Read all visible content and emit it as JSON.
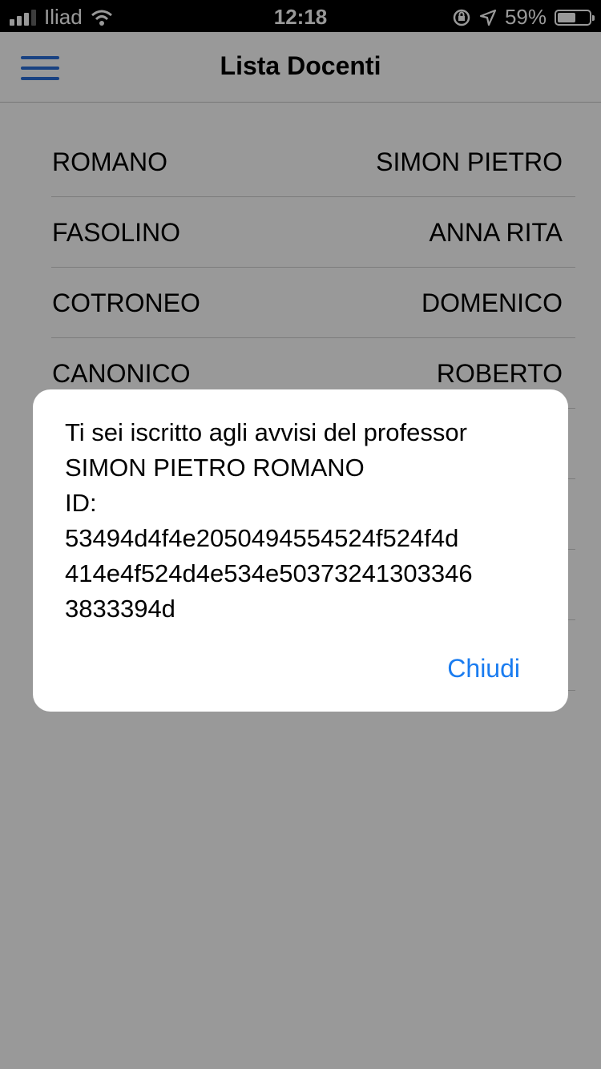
{
  "status_bar": {
    "carrier": "Iliad",
    "time": "12:18",
    "battery_percent": "59%",
    "battery_level": 0.59,
    "icons": [
      "signal-icon",
      "wifi-icon",
      "orientation-lock-icon",
      "location-icon",
      "battery-icon"
    ]
  },
  "navbar": {
    "title": "Lista Docenti",
    "menu_icon": "hamburger-icon",
    "accent_color": "#2b6ed9"
  },
  "teachers": [
    {
      "surname": "ROMANO",
      "name": "SIMON PIETRO"
    },
    {
      "surname": "FASOLINO",
      "name": "ANNA RITA"
    },
    {
      "surname": "COTRONEO",
      "name": "DOMENICO"
    },
    {
      "surname": "CANONICO",
      "name": "ROBERTO"
    }
  ],
  "dialog": {
    "line1": "Ti sei iscritto agli avvisi del professor",
    "line2": "SIMON PIETRO ROMANO",
    "line3": "ID:",
    "line4": "53494d4f4e2050494554524f524f4d",
    "line5": "414e4f524d4e534e50373241303346",
    "line6": "3833394d",
    "button_label": "Chiudi",
    "button_color": "#1a7cf0"
  }
}
